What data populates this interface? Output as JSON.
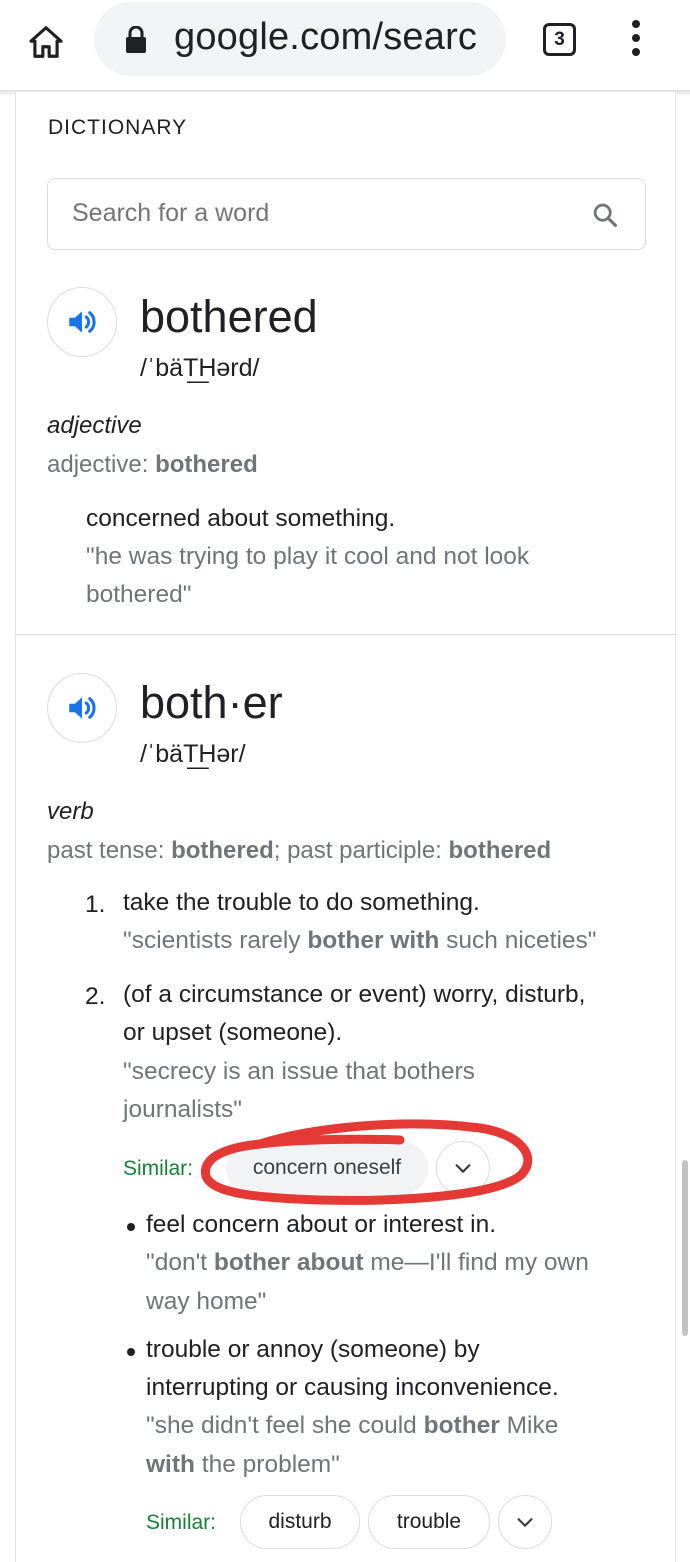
{
  "browser": {
    "url": "google.com/searc",
    "tab_count": "3"
  },
  "dictionary": {
    "section_label": "DICTIONARY",
    "search_placeholder": "Search for a word"
  },
  "entries": [
    {
      "headword": "bothered",
      "phonetic": "/ˈbäT͟Hərd/",
      "part_of_speech": "adjective",
      "forms_prefix": "adjective: ",
      "forms_bold": "bothered",
      "definitions": [
        {
          "text": "concerned about something.",
          "example_line1": "\"he was trying to play it cool and not look",
          "example_line2": "bothered\""
        }
      ]
    },
    {
      "headword": "both·er",
      "phonetic": "/ˈbäT͟Hər/",
      "part_of_speech": "verb",
      "forms_prefix1": "past tense: ",
      "forms_bold1": "bothered",
      "forms_prefix2": "; past participle: ",
      "forms_bold2": "bothered",
      "definitions": [
        {
          "number": "1.",
          "text": "take the trouble to do something.",
          "example_pre": "\"scientists rarely ",
          "example_bold": "bother with",
          "example_post": " such niceties\""
        },
        {
          "number": "2.",
          "text_line1": "(of a circumstance or event) worry, disturb,",
          "text_line2": "or upset (someone).",
          "example_line1": "\"secrecy is an issue that bothers",
          "example_line2": "journalists\"",
          "similar_label": "Similar:",
          "similar": [
            "concern oneself"
          ],
          "subsenses": [
            {
              "text": "feel concern about or interest in.",
              "example_pre": "\"don't ",
              "example_bold": "bother about",
              "example_post": " me—I'll find my own",
              "example_line2": "way home\""
            },
            {
              "text_line1": "trouble or annoy (someone) by",
              "text_line2": "interrupting or causing inconvenience.",
              "example_pre": "\"she didn't feel she could ",
              "example_bold": "bother",
              "example_post": " Mike",
              "example_line2_bold": "with",
              "example_line2_post": " the problem\"",
              "similar_label": "Similar:",
              "similar": [
                "disturb",
                "trouble"
              ]
            }
          ]
        }
      ]
    }
  ],
  "colors": {
    "speaker_blue": "#1a73e8",
    "similar_green": "#188038",
    "annotation_red": "#e53935",
    "muted_gray": "#70757a"
  },
  "icons": [
    "home-icon",
    "lock-icon",
    "tab-switcher-icon",
    "more-options-icon",
    "search-icon",
    "speaker-icon",
    "chevron-down-icon"
  ]
}
